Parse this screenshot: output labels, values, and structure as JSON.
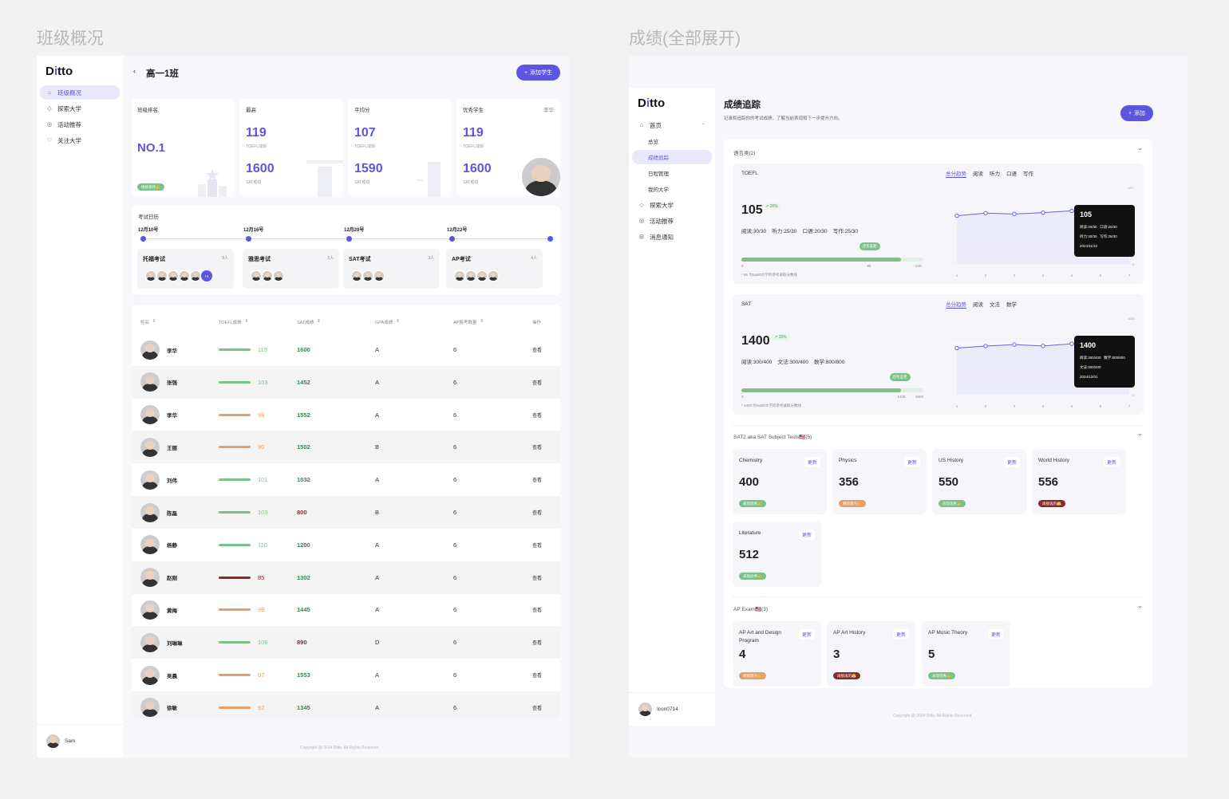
{
  "left": {
    "section_title": "班级概况",
    "logo": "Ditto",
    "nav": [
      {
        "label": "班级概况",
        "icon": "home-icon"
      },
      {
        "label": "探索大学",
        "icon": "graduation-cap-icon"
      },
      {
        "label": "活动推荐",
        "icon": "compass-icon"
      },
      {
        "label": "关注大学",
        "icon": "heart-icon"
      }
    ],
    "user": "Sam",
    "page_title": "高一1班",
    "add_button": "添加学生",
    "stats": {
      "rank_label": "班级排名",
      "rank_value": "NO.1",
      "rank_badge": "继续保持💪",
      "high_label": "最高",
      "high_toefl": "119",
      "high_toefl_label": "TOEFL成绩",
      "high_sat": "1600",
      "high_sat_label": "SAT成绩",
      "avg_label": "平均分",
      "avg_toefl": "107",
      "avg_toefl_label": "TOEFL成绩",
      "avg_sat": "1590",
      "avg_sat_label": "SAT成绩",
      "top_label": "优秀学生",
      "top_name": "李华",
      "top_toefl": "119",
      "top_toefl_label": "TOEFL成绩",
      "top_sat": "1600",
      "top_sat_label": "SAT成绩"
    },
    "calendar": {
      "title": "考试日历",
      "dates": [
        "12月10号",
        "12月16号",
        "12月20号",
        "12月22号"
      ],
      "exams": [
        {
          "name": "托福考试",
          "count": "9人",
          "avatars": 5,
          "more": "+4"
        },
        {
          "name": "雅思考试",
          "count": "3人",
          "avatars": 3,
          "more": ""
        },
        {
          "name": "SAT考试",
          "count": "3人",
          "avatars": 3,
          "more": ""
        },
        {
          "name": "AP考试",
          "count": "4人",
          "avatars": 4,
          "more": ""
        }
      ]
    },
    "table": {
      "headers": [
        "姓名",
        "TOEFL成绩",
        "SAT成绩",
        "GPA成绩",
        "AP报考数量",
        "操作"
      ],
      "rows": [
        {
          "name": "李华",
          "toefl": "119",
          "toefl_color": "#7ac28a",
          "sat": "1600",
          "sat_color": "#2f8a4a",
          "gpa": "A",
          "ap": "6",
          "action": "查看"
        },
        {
          "name": "张强",
          "toefl": "103",
          "toefl_color": "#7ac28a",
          "sat": "1452",
          "sat_color": "#2f8a4a",
          "gpa": "A",
          "ap": "6",
          "action": "查看"
        },
        {
          "name": "李华",
          "toefl": "98",
          "toefl_color": "#e5a06a",
          "sat": "1552",
          "sat_color": "#2f8a4a",
          "gpa": "A",
          "ap": "6",
          "action": "查看"
        },
        {
          "name": "王丽",
          "toefl": "90",
          "toefl_color": "#e5a06a",
          "sat": "1502",
          "sat_color": "#2f8a4a",
          "gpa": "B",
          "ap": "6",
          "action": "查看"
        },
        {
          "name": "刘伟",
          "toefl": "101",
          "toefl_color": "#7ac28a",
          "sat": "1032",
          "sat_color": "#2f8a4a",
          "gpa": "A",
          "ap": "6",
          "action": "查看"
        },
        {
          "name": "陈磊",
          "toefl": "103",
          "toefl_color": "#7ac28a",
          "sat": "800",
          "sat_color": "#8a2b2b",
          "gpa": "B",
          "ap": "6",
          "action": "查看"
        },
        {
          "name": "杨静",
          "toefl": "110",
          "toefl_color": "#7ac28a",
          "sat": "1200",
          "sat_color": "#2f8a4a",
          "gpa": "A",
          "ap": "6",
          "action": "查看"
        },
        {
          "name": "赵刚",
          "toefl": "85",
          "toefl_color": "#8a2b2b",
          "sat": "1302",
          "sat_color": "#2f8a4a",
          "gpa": "A",
          "ap": "6",
          "action": "查看"
        },
        {
          "name": "黄梅",
          "toefl": "99",
          "toefl_color": "#e5a06a",
          "sat": "1445",
          "sat_color": "#2f8a4a",
          "gpa": "A",
          "ap": "6",
          "action": "查看"
        },
        {
          "name": "刘琳琳",
          "toefl": "108",
          "toefl_color": "#7ac28a",
          "sat": "890",
          "sat_color": "#8a2b2b",
          "gpa": "D",
          "ap": "6",
          "action": "查看"
        },
        {
          "name": "吴晨",
          "toefl": "97",
          "toefl_color": "#e5a06a",
          "sat": "1553",
          "sat_color": "#2f8a4a",
          "gpa": "A",
          "ap": "6",
          "action": "查看"
        },
        {
          "name": "徐敏",
          "toefl": "92",
          "toefl_color": "#e5a06a",
          "sat": "1345",
          "sat_color": "#2f8a4a",
          "gpa": "A",
          "ap": "6",
          "action": "查看"
        }
      ]
    },
    "copyright": "Copyright @ 2024 Ditto. All Rights Reserved"
  },
  "right": {
    "section_title": "成绩(全部展开)",
    "logo": "Ditto",
    "nav": [
      {
        "label": "首页",
        "icon": "home-icon",
        "sub": false,
        "active": false
      },
      {
        "label": "总览",
        "icon": "",
        "sub": true,
        "active": false
      },
      {
        "label": "成绩追踪",
        "icon": "",
        "sub": true,
        "active": true
      },
      {
        "label": "日程管理",
        "icon": "",
        "sub": true,
        "active": false
      },
      {
        "label": "我的大学",
        "icon": "",
        "sub": true,
        "active": false
      },
      {
        "label": "探索大学",
        "icon": "graduation-cap-icon",
        "sub": false,
        "active": false
      },
      {
        "label": "活动推荐",
        "icon": "compass-icon",
        "sub": false,
        "active": false
      },
      {
        "label": "消息通知",
        "icon": "inbox-icon",
        "sub": false,
        "active": false
      }
    ],
    "user": "Icon0714",
    "page_title": "成绩追踪",
    "page_subtitle": "记录和追踪你的考试成绩，了解当前表现和下一步提升方向。",
    "add_button": "添加",
    "lang_group": "语言类(2)",
    "toefl": {
      "label": "TOEFL",
      "score": "105",
      "delta": "25%",
      "detail": "阅读:30/30    听力:25/30    口语:20/30    写作:25/30",
      "tabs": [
        "总分趋势",
        "阅读",
        "听力",
        "口语",
        "写作"
      ],
      "bar_label": "还有差距",
      "bar_min": "0",
      "bar_mid": "85",
      "bar_max": "120",
      "note": "* 85 为top50大学的参考录取分数线",
      "tooltip_score": "105",
      "tooltip_l1": "阅读:30/30   口语:20/30",
      "tooltip_l2": "听力:30/30   写作:25/30",
      "tooltip_date": "2024/11/12",
      "y_top": "120",
      "y_bottom": "0"
    },
    "sat": {
      "label": "SAT",
      "score": "1400",
      "delta": "15%",
      "detail": "阅读:300/400    文法:300/400    数学:800/800",
      "tabs": [
        "总分趋势",
        "阅读",
        "文法",
        "数学"
      ],
      "bar_label": "还有差距",
      "bar_min": "0",
      "bar_mid": "1400",
      "bar_max": "1600",
      "note": "* 1400 为top50大学的参考录取分数线",
      "tooltip_score": "1400",
      "tooltip_l1": "阅读:300/400   数学:800/800",
      "tooltip_l2": "文法:300/400",
      "tooltip_date": "2024/12/01",
      "y_top": "1600",
      "y_bottom": "0"
    },
    "chart_data": [
      {
        "type": "line",
        "title": "",
        "x": [
          "1",
          "2",
          "3",
          "4",
          "5",
          "6",
          "7"
        ],
        "series": [
          {
            "values": [
              92,
              98,
              96,
              99,
              103,
              96,
              105
            ]
          }
        ],
        "ylim": [
          0,
          120
        ]
      },
      {
        "type": "line",
        "title": "",
        "x": [
          "1",
          "2",
          "3",
          "4",
          "5",
          "6",
          "7"
        ],
        "series": [
          {
            "values": [
              1180,
              1240,
              1285,
              1245,
              1310,
              1300,
              1400
            ]
          }
        ],
        "ylim": [
          0,
          1600
        ]
      }
    ],
    "sat2_group": "SAT2 aka SAT Subject Tests🇺🇸(5)",
    "sat2": [
      {
        "name": "Chemistry",
        "score": "400",
        "update": "更新",
        "badge": "表现优秀👍",
        "badge_class": "b-green"
      },
      {
        "name": "Physics",
        "score": "356",
        "update": "更新",
        "badge": "继续努力💪",
        "badge_class": "b-orange"
      },
      {
        "name": "US History",
        "score": "550",
        "update": "更新",
        "badge": "表现优秀👍",
        "badge_class": "b-green"
      },
      {
        "name": "World History",
        "score": "556",
        "update": "更新",
        "badge": "再接再厉😤",
        "badge_class": "b-red"
      },
      {
        "name": "Literature",
        "score": "512",
        "update": "更新",
        "badge": "表现优秀👍",
        "badge_class": "b-green"
      }
    ],
    "ap_group": "AP Exam🇺🇸(3)",
    "ap": [
      {
        "name": "AP Art and Design Program",
        "score": "4",
        "update": "更新",
        "badge": "继续努力💪",
        "badge_class": "b-orange"
      },
      {
        "name": "AP Art History",
        "score": "3",
        "update": "更新",
        "badge": "再接再厉😤",
        "badge_class": "b-red"
      },
      {
        "name": "AP Music Theory",
        "score": "5",
        "update": "更新",
        "badge": "表现优秀👍",
        "badge_class": "b-green"
      }
    ],
    "copyright": "Copyright @ 2024 Ditto. All Rights Reserved"
  }
}
